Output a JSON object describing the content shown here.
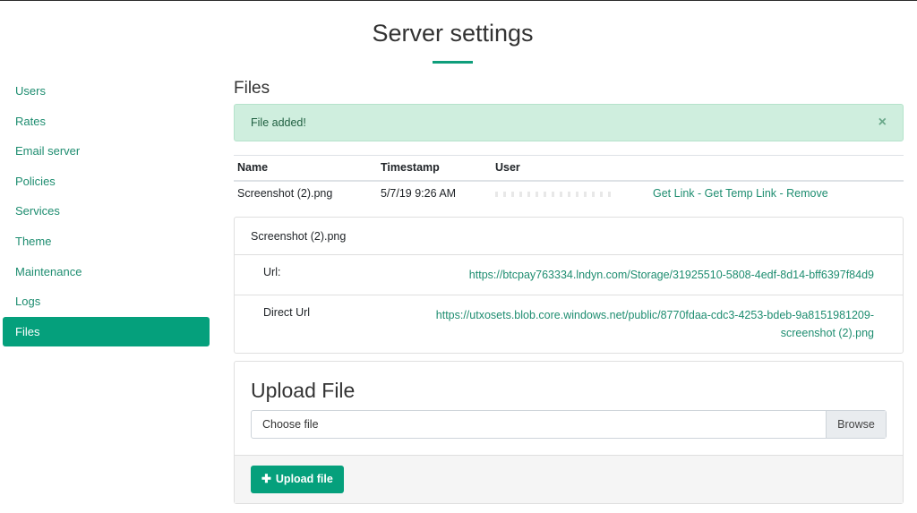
{
  "page": {
    "title": "Server settings"
  },
  "sidebar": {
    "items": [
      {
        "label": "Users"
      },
      {
        "label": "Rates"
      },
      {
        "label": "Email server"
      },
      {
        "label": "Policies"
      },
      {
        "label": "Services"
      },
      {
        "label": "Theme"
      },
      {
        "label": "Maintenance"
      },
      {
        "label": "Logs"
      },
      {
        "label": "Files",
        "active": true
      }
    ]
  },
  "files": {
    "title": "Files",
    "alert": {
      "message": "File added!",
      "close": "×"
    },
    "table": {
      "headers": {
        "name": "Name",
        "timestamp": "Timestamp",
        "user": "User"
      },
      "rows": [
        {
          "name": "Screenshot (2).png",
          "timestamp": "5/7/19 9:26 AM",
          "get_link": "Get Link",
          "get_temp_link": "Get Temp Link",
          "remove": "Remove",
          "separator": " - "
        }
      ]
    },
    "details": {
      "file_name": "Screenshot (2).png",
      "url_label": "Url:",
      "url_value": "https://btcpay763334.lndyn.com/Storage/31925510-5808-4edf-8d14-bff6397f84d9",
      "direct_url_label": "Direct Url",
      "direct_url_value": "https://utxosets.blob.core.windows.net/public/8770fdaa-cdc3-4253-bdeb-9a8151981209-screenshot (2).png"
    }
  },
  "upload": {
    "title": "Upload File",
    "choose_placeholder": "Choose file",
    "browse_label": "Browse",
    "button_label": "Upload file",
    "button_icon": "plus-icon"
  },
  "colors": {
    "accent": "#05a07c",
    "link": "#1e8d70",
    "alert_bg": "#cfeede"
  }
}
